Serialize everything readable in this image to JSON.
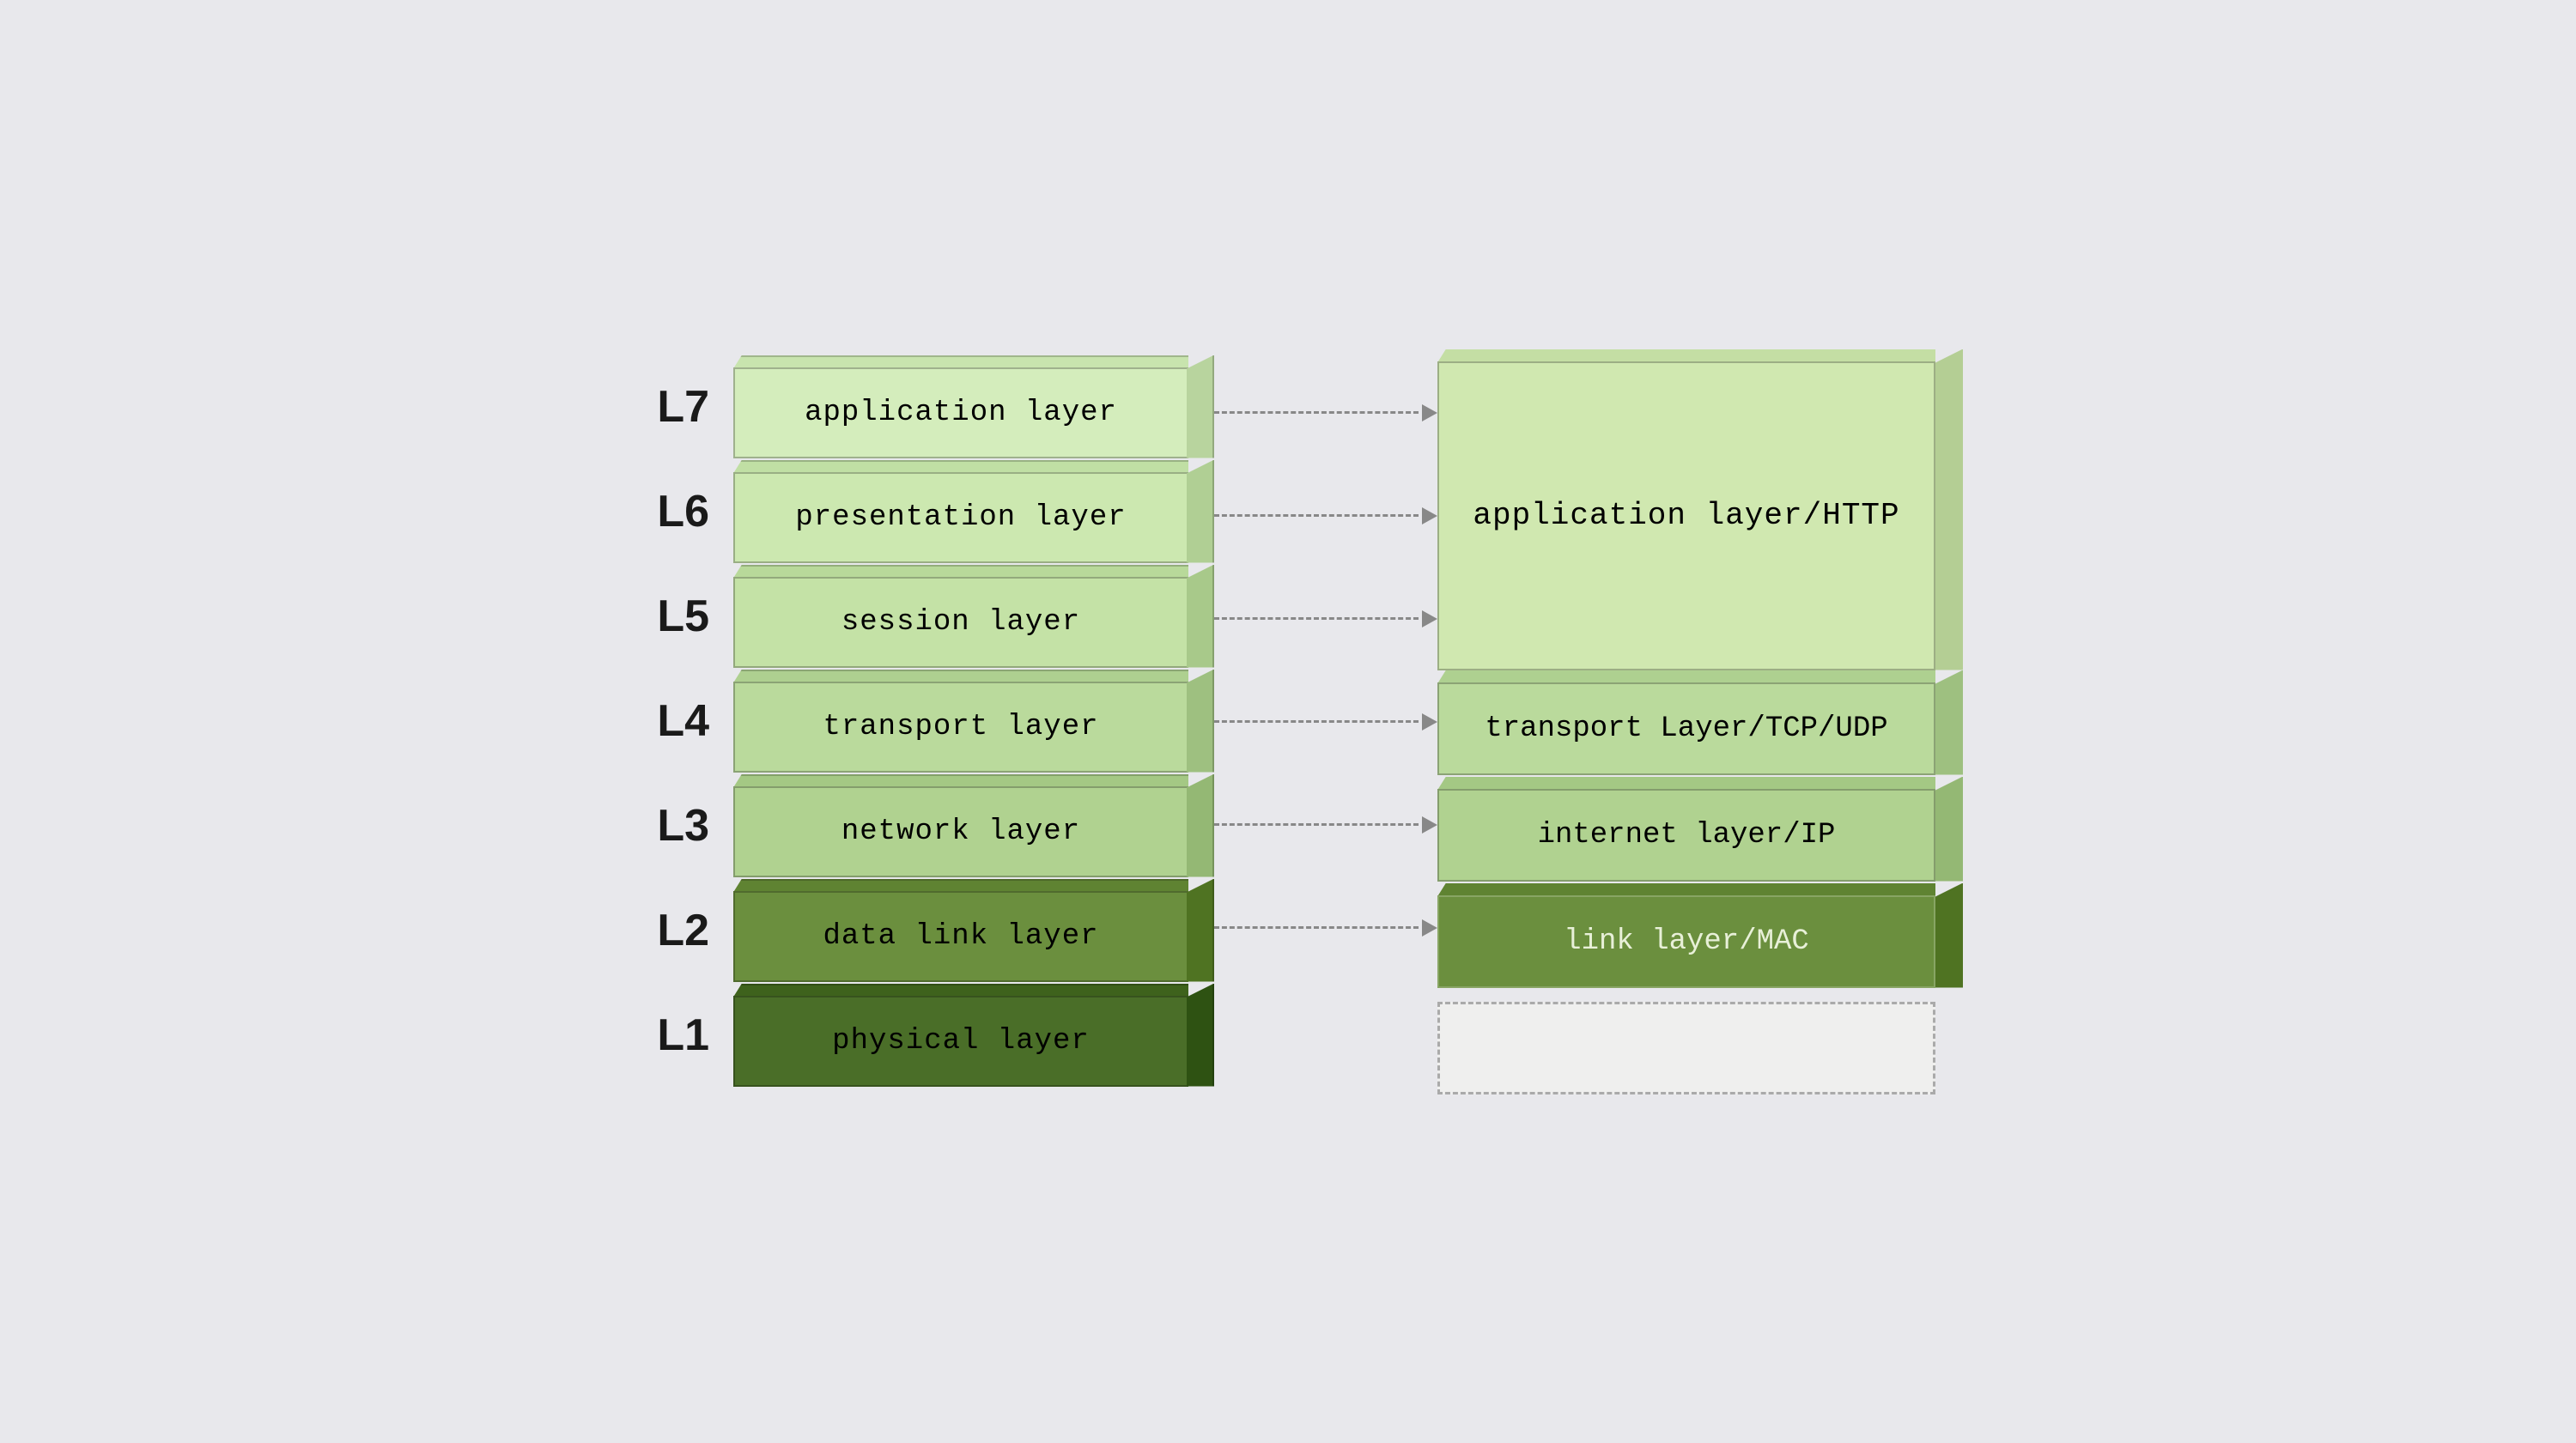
{
  "left_layers": [
    {
      "id": "l7",
      "label": "L7",
      "text": "application layer",
      "color_class": "color-l7"
    },
    {
      "id": "l6",
      "label": "L6",
      "text": "presentation layer",
      "color_class": "color-l6"
    },
    {
      "id": "l5",
      "label": "L5",
      "text": "session layer",
      "color_class": "color-l5"
    },
    {
      "id": "l4",
      "label": "L4",
      "text": "transport layer",
      "color_class": "color-l4"
    },
    {
      "id": "l3",
      "label": "L3",
      "text": "network layer",
      "color_class": "color-l3"
    },
    {
      "id": "l2",
      "label": "L2",
      "text": "data link layer",
      "color_class": "color-l2"
    },
    {
      "id": "l1",
      "label": "L1",
      "text": "physical layer",
      "color_class": "color-l1"
    }
  ],
  "right_layers": [
    {
      "id": "app",
      "text": "application layer/HTTP",
      "span": 3
    },
    {
      "id": "transport",
      "text": "transport Layer/TCP/UDP",
      "span": 1
    },
    {
      "id": "internet",
      "text": "internet layer/IP",
      "span": 1
    },
    {
      "id": "link",
      "text": "link layer/MAC",
      "span": 1
    },
    {
      "id": "empty",
      "text": "",
      "span": 1
    }
  ]
}
